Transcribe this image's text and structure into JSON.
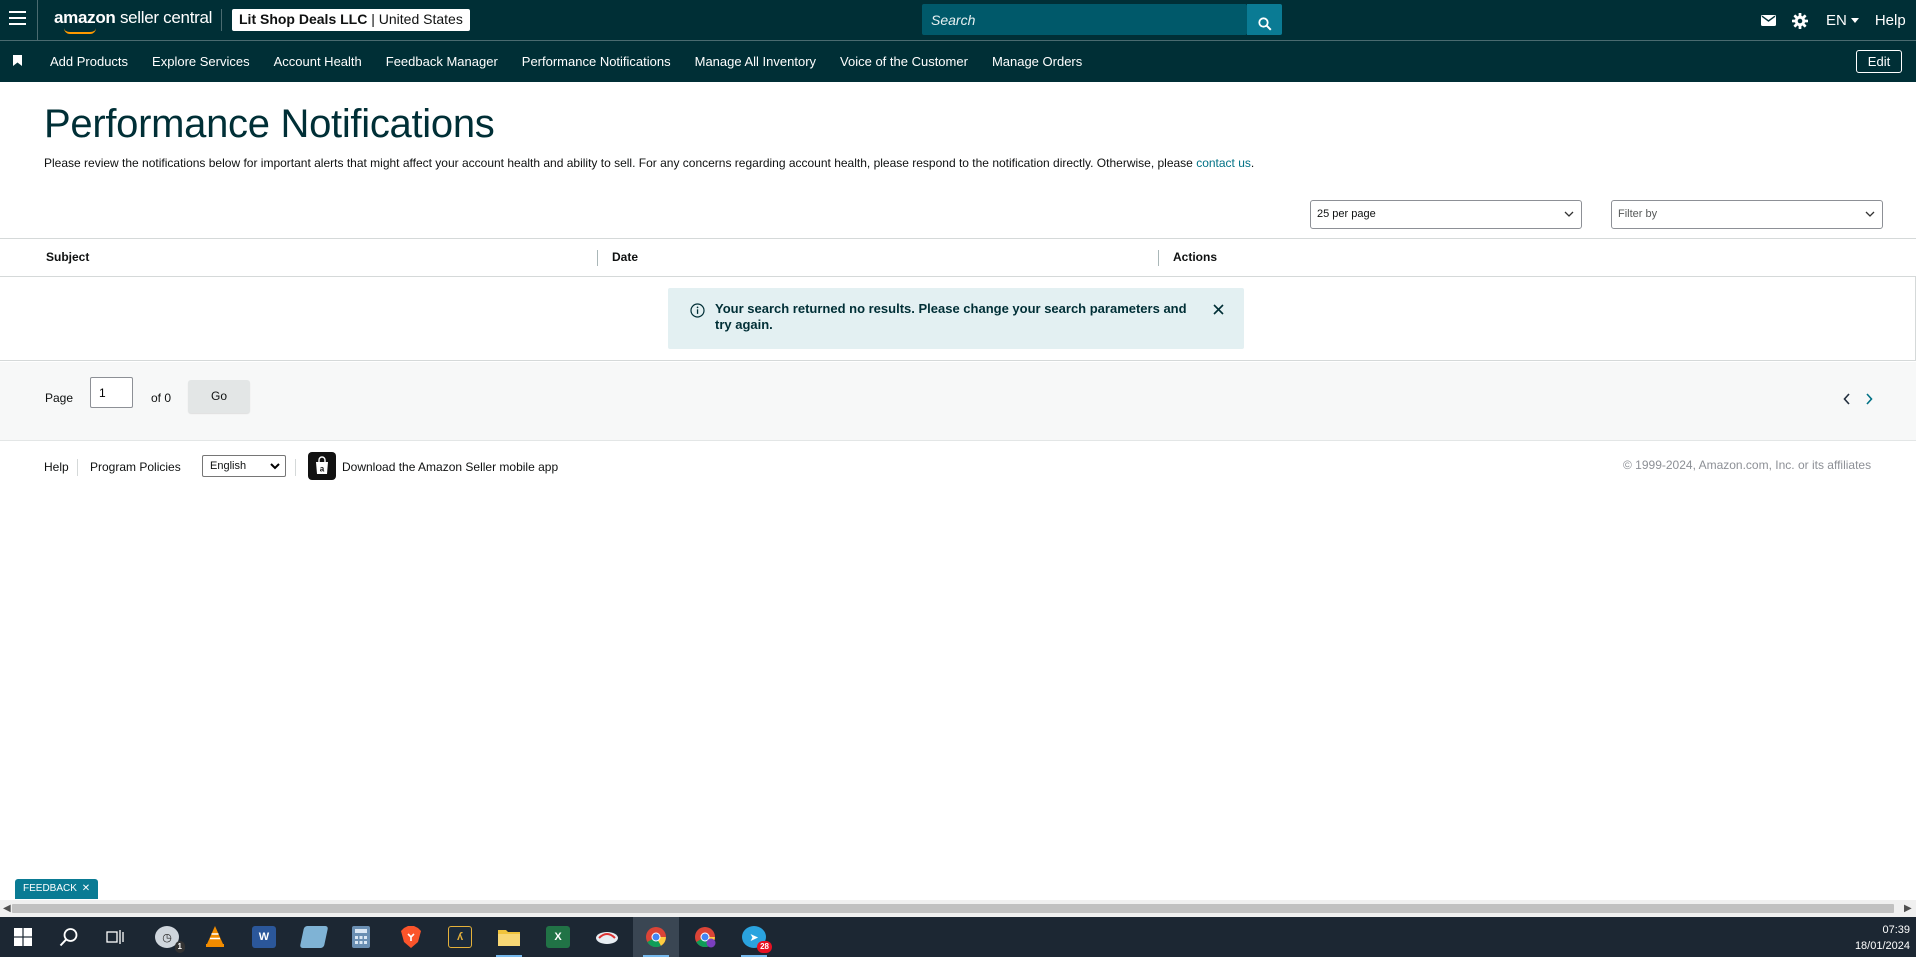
{
  "header": {
    "logo_brand": "amazon",
    "logo_product": "seller central",
    "store_name": "Lit Shop Deals LLC",
    "store_separator": "|",
    "store_region": "United States",
    "search_placeholder": "Search",
    "language": "EN",
    "help": "Help"
  },
  "nav": {
    "items": [
      {
        "label": "Add Products"
      },
      {
        "label": "Explore Services"
      },
      {
        "label": "Account Health"
      },
      {
        "label": "Feedback Manager"
      },
      {
        "label": "Performance Notifications"
      },
      {
        "label": "Manage All Inventory"
      },
      {
        "label": "Voice of the Customer"
      },
      {
        "label": "Manage Orders"
      }
    ],
    "edit": "Edit"
  },
  "main": {
    "title": "Performance Notifications",
    "intro": "Please review the notifications below for important alerts that might affect your account health and ability to sell. For any concerns regarding account health, please respond to the notification directly. Otherwise, please ",
    "intro_link": "contact us",
    "intro_end": ".",
    "per_page": "25 per page",
    "filter_placeholder": "Filter by",
    "columns": [
      "Subject",
      "Date",
      "Actions"
    ],
    "alert_message": "Your search returned no results. Please change your search parameters and try again."
  },
  "pager": {
    "page_label": "Page",
    "page_value": "1",
    "of_label": "of 0",
    "go": "Go"
  },
  "footer": {
    "help": "Help",
    "program_policies": "Program Policies",
    "language": "English",
    "app_download": "Download the Amazon Seller mobile app",
    "copyright": "© 1999-2024, Amazon.com, Inc. or its affiliates"
  },
  "feedback": "FEEDBACK",
  "taskbar": {
    "time": "07:39",
    "date": "18/01/2024",
    "telegram_badge": "28",
    "clock_badge": "1"
  },
  "colors": {
    "header_bg": "#002f36",
    "accent": "#0a7b94",
    "alert_bg": "#e3f0f2",
    "link": "#007185"
  }
}
